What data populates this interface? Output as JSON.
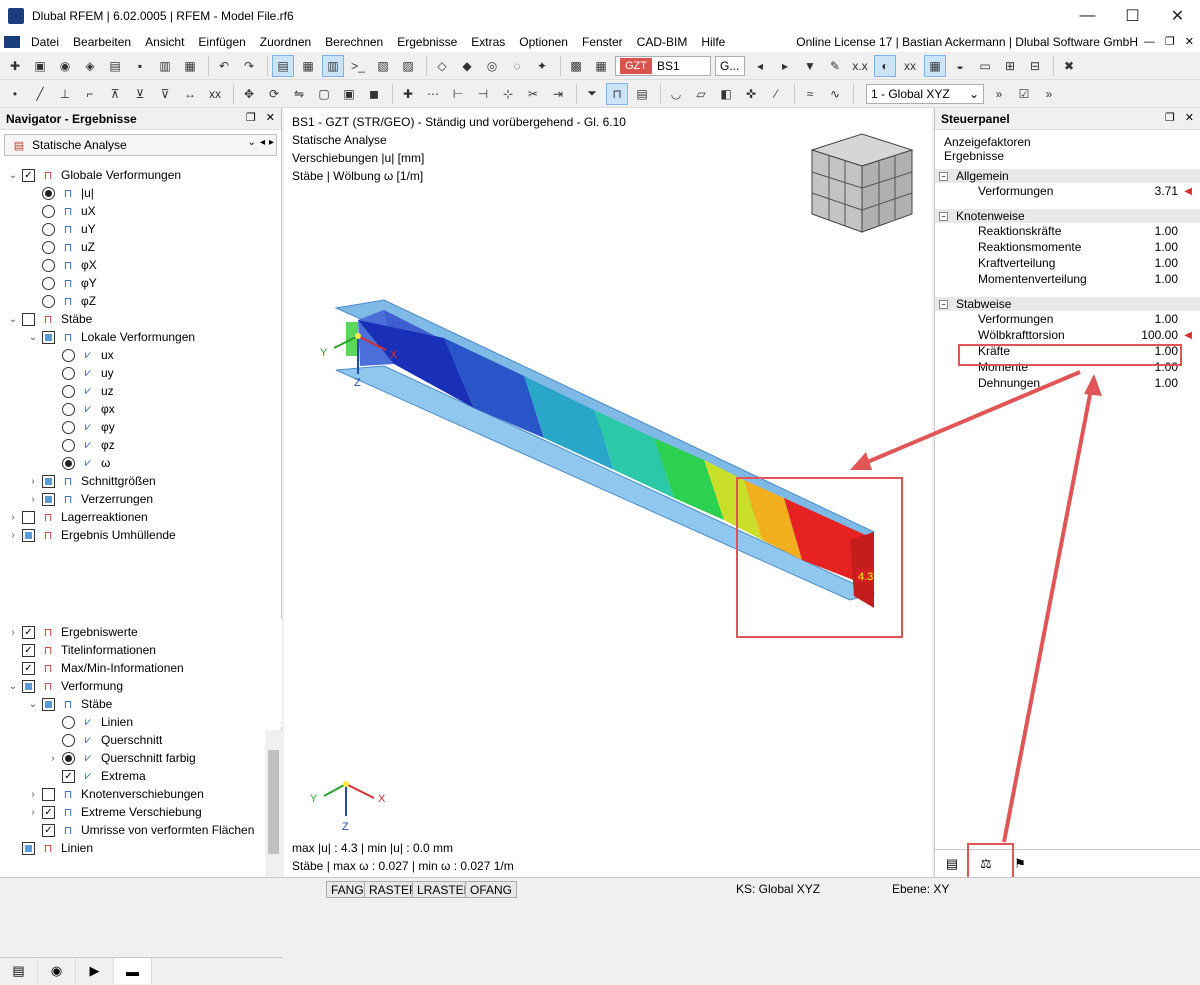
{
  "window": {
    "title": "Dlubal RFEM | 6.02.0005 | RFEM - Model File.rf6",
    "minimize": "—",
    "maximize": "☐",
    "close": "✕"
  },
  "menu": {
    "items": [
      "Datei",
      "Bearbeiten",
      "Ansicht",
      "Einfügen",
      "Zuordnen",
      "Berechnen",
      "Ergebnisse",
      "Extras",
      "Optionen",
      "Fenster",
      "CAD-BIM",
      "Hilfe"
    ],
    "license": "Online License 17 | Bastian Ackermann | Dlubal Software GmbH"
  },
  "toolbar": {
    "loadcase_badge": "GZT",
    "loadcase": "BS1",
    "loadcase_type": "G...",
    "coordinate_system": "1 - Global XYZ"
  },
  "navigator": {
    "title": "Navigator - Ergebnisse",
    "combo": "Statische Analyse",
    "tree": [
      {
        "label": "Globale Verformungen",
        "level": 0,
        "exp": "open",
        "cb": "checked"
      },
      {
        "label": "|u|",
        "level": 1,
        "radio": "on"
      },
      {
        "label": "uX",
        "level": 1,
        "radio": "off"
      },
      {
        "label": "uY",
        "level": 1,
        "radio": "off"
      },
      {
        "label": "uZ",
        "level": 1,
        "radio": "off"
      },
      {
        "label": "φX",
        "level": 1,
        "radio": "off"
      },
      {
        "label": "φY",
        "level": 1,
        "radio": "off"
      },
      {
        "label": "φZ",
        "level": 1,
        "radio": "off"
      },
      {
        "label": "Stäbe",
        "level": 0,
        "exp": "open",
        "cb": "unchecked"
      },
      {
        "label": "Lokale Verformungen",
        "level": 1,
        "exp": "open",
        "cb": "partial"
      },
      {
        "label": "ux",
        "level": 2,
        "radio": "off"
      },
      {
        "label": "uy",
        "level": 2,
        "radio": "off"
      },
      {
        "label": "uz",
        "level": 2,
        "radio": "off"
      },
      {
        "label": "φx",
        "level": 2,
        "radio": "off"
      },
      {
        "label": "φy",
        "level": 2,
        "radio": "off"
      },
      {
        "label": "φz",
        "level": 2,
        "radio": "off"
      },
      {
        "label": "ω",
        "level": 2,
        "radio": "on"
      },
      {
        "label": "Schnittgrößen",
        "level": 1,
        "exp": "closed",
        "cb": "partial"
      },
      {
        "label": "Verzerrungen",
        "level": 1,
        "exp": "closed",
        "cb": "partial"
      },
      {
        "label": "Lagerreaktionen",
        "level": 0,
        "exp": "closed",
        "cb": "unchecked"
      },
      {
        "label": "Ergebnis Umhüllende",
        "level": 0,
        "exp": "closed",
        "cb": "partial"
      }
    ],
    "tree2": [
      {
        "label": "Ergebniswerte",
        "level": 0,
        "exp": "closed",
        "cb": "checked"
      },
      {
        "label": "Titelinformationen",
        "level": 0,
        "cb": "checked"
      },
      {
        "label": "Max/Min-Informationen",
        "level": 0,
        "cb": "checked"
      },
      {
        "label": "Verformung",
        "level": 0,
        "exp": "open",
        "cb": "partial"
      },
      {
        "label": "Stäbe",
        "level": 1,
        "exp": "open",
        "cb": "partial"
      },
      {
        "label": "Linien",
        "level": 2,
        "radio": "off"
      },
      {
        "label": "Querschnitt",
        "level": 2,
        "radio": "off"
      },
      {
        "label": "Querschnitt farbig",
        "level": 2,
        "exp": "closed",
        "radio": "on"
      },
      {
        "label": "Extrema",
        "level": 2,
        "cb": "checked"
      },
      {
        "label": "Knotenverschiebungen",
        "level": 1,
        "exp": "closed",
        "cb": "unchecked"
      },
      {
        "label": "Extreme Verschiebung",
        "level": 1,
        "exp": "closed",
        "cb": "checked"
      },
      {
        "label": "Umrisse von verformten Flächen",
        "level": 1,
        "cb": "checked"
      },
      {
        "label": "Linien",
        "level": 0,
        "cb": "partial"
      }
    ]
  },
  "viewport": {
    "info_lines": [
      "BS1 - GZT (STR/GEO) - Ständig und vorübergehend - Gl. 6.10",
      "Statische Analyse",
      "Verschiebungen |u| [mm]",
      "Stäbe | Wölbung ω [1/m]"
    ],
    "bottom_lines": [
      "max |u| : 4.3 | min |u| : 0.0 mm",
      "Stäbe | max ω : 0.027 | min ω : 0.027 1/m"
    ],
    "extreme_label": "4.3",
    "axis_labels": {
      "x": "X",
      "y": "Y",
      "z": "Z"
    }
  },
  "steuerpanel": {
    "title": "Steuerpanel",
    "subtitle1": "Anzeigefaktoren",
    "subtitle2": "Ergebnisse",
    "sections": [
      {
        "name": "Allgemein",
        "rows": [
          {
            "label": "Verformungen",
            "value": "3.71",
            "flag": true
          }
        ]
      },
      {
        "name": "Knotenweise",
        "rows": [
          {
            "label": "Reaktionskräfte",
            "value": "1.00"
          },
          {
            "label": "Reaktionsmomente",
            "value": "1.00"
          },
          {
            "label": "Kraftverteilung",
            "value": "1.00"
          },
          {
            "label": "Momentenverteilung",
            "value": "1.00"
          }
        ]
      },
      {
        "name": "Stabweise",
        "rows": [
          {
            "label": "Verformungen",
            "value": "1.00"
          },
          {
            "label": "Wölbkrafttorsion",
            "value": "100.00",
            "flag": true
          },
          {
            "label": "Kräfte",
            "value": "1.00"
          },
          {
            "label": "Momente",
            "value": "1.00"
          },
          {
            "label": "Dehnungen",
            "value": "1.00"
          }
        ]
      }
    ]
  },
  "statusbar": {
    "buttons": [
      "FANG",
      "RASTER",
      "LRASTER",
      "OFANG"
    ],
    "ks": "KS: Global XYZ",
    "ebene": "Ebene: XY"
  },
  "colors": {
    "accent_red": "#e05555",
    "selection_blue": "#cce4f7"
  }
}
